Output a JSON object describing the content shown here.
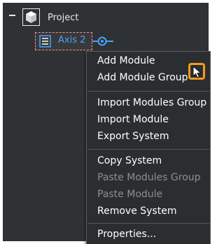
{
  "tree": {
    "project_label": "Project",
    "axis_label": "Axis 2"
  },
  "context_menu": {
    "items": [
      {
        "label": "Add Module",
        "enabled": true
      },
      {
        "label": "Add Module Group",
        "enabled": true
      },
      {
        "label": "Import Modules Group",
        "enabled": true
      },
      {
        "label": "Import Module",
        "enabled": true
      },
      {
        "label": "Export System",
        "enabled": true
      },
      {
        "label": "Copy System",
        "enabled": true
      },
      {
        "label": "Paste Modules Group",
        "enabled": false
      },
      {
        "label": "Paste Module",
        "enabled": false
      },
      {
        "label": "Remove System",
        "enabled": true
      },
      {
        "label": "Properties...",
        "enabled": true
      }
    ]
  },
  "colors": {
    "panel_bg": "#2f3234",
    "menu_bg": "#2b2e30",
    "axis_text": "#4aa0ff",
    "highlight_orange": "#f39a1d",
    "disabled_text": "#8b8f93"
  },
  "icons": {
    "project": "cube-icon",
    "axis": "axis-module-icon",
    "connector": "connector-icon",
    "cursor": "mouse-pointer-icon"
  }
}
